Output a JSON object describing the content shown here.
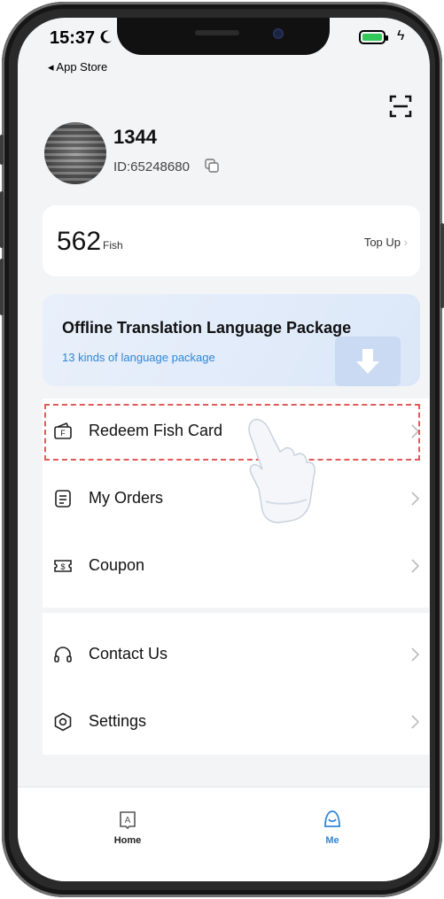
{
  "status": {
    "time": "15:37",
    "back_label": "◂ App Store"
  },
  "profile": {
    "name": "1344",
    "id": "ID:65248680"
  },
  "balance": {
    "amount": "562",
    "unit": "Fish",
    "action": "Top Up"
  },
  "offline_pack": {
    "title": "Offline Translation Language Package",
    "subtitle": "13 kinds of language package"
  },
  "menu": {
    "redeem": "Redeem Fish Card",
    "orders": "My Orders",
    "coupon": "Coupon",
    "contact": "Contact Us",
    "settings": "Settings"
  },
  "tabs": {
    "home": "Home",
    "me": "Me"
  },
  "colors": {
    "accent": "#2f86d6",
    "highlight": "#e05a5a",
    "battery": "#34c759"
  }
}
